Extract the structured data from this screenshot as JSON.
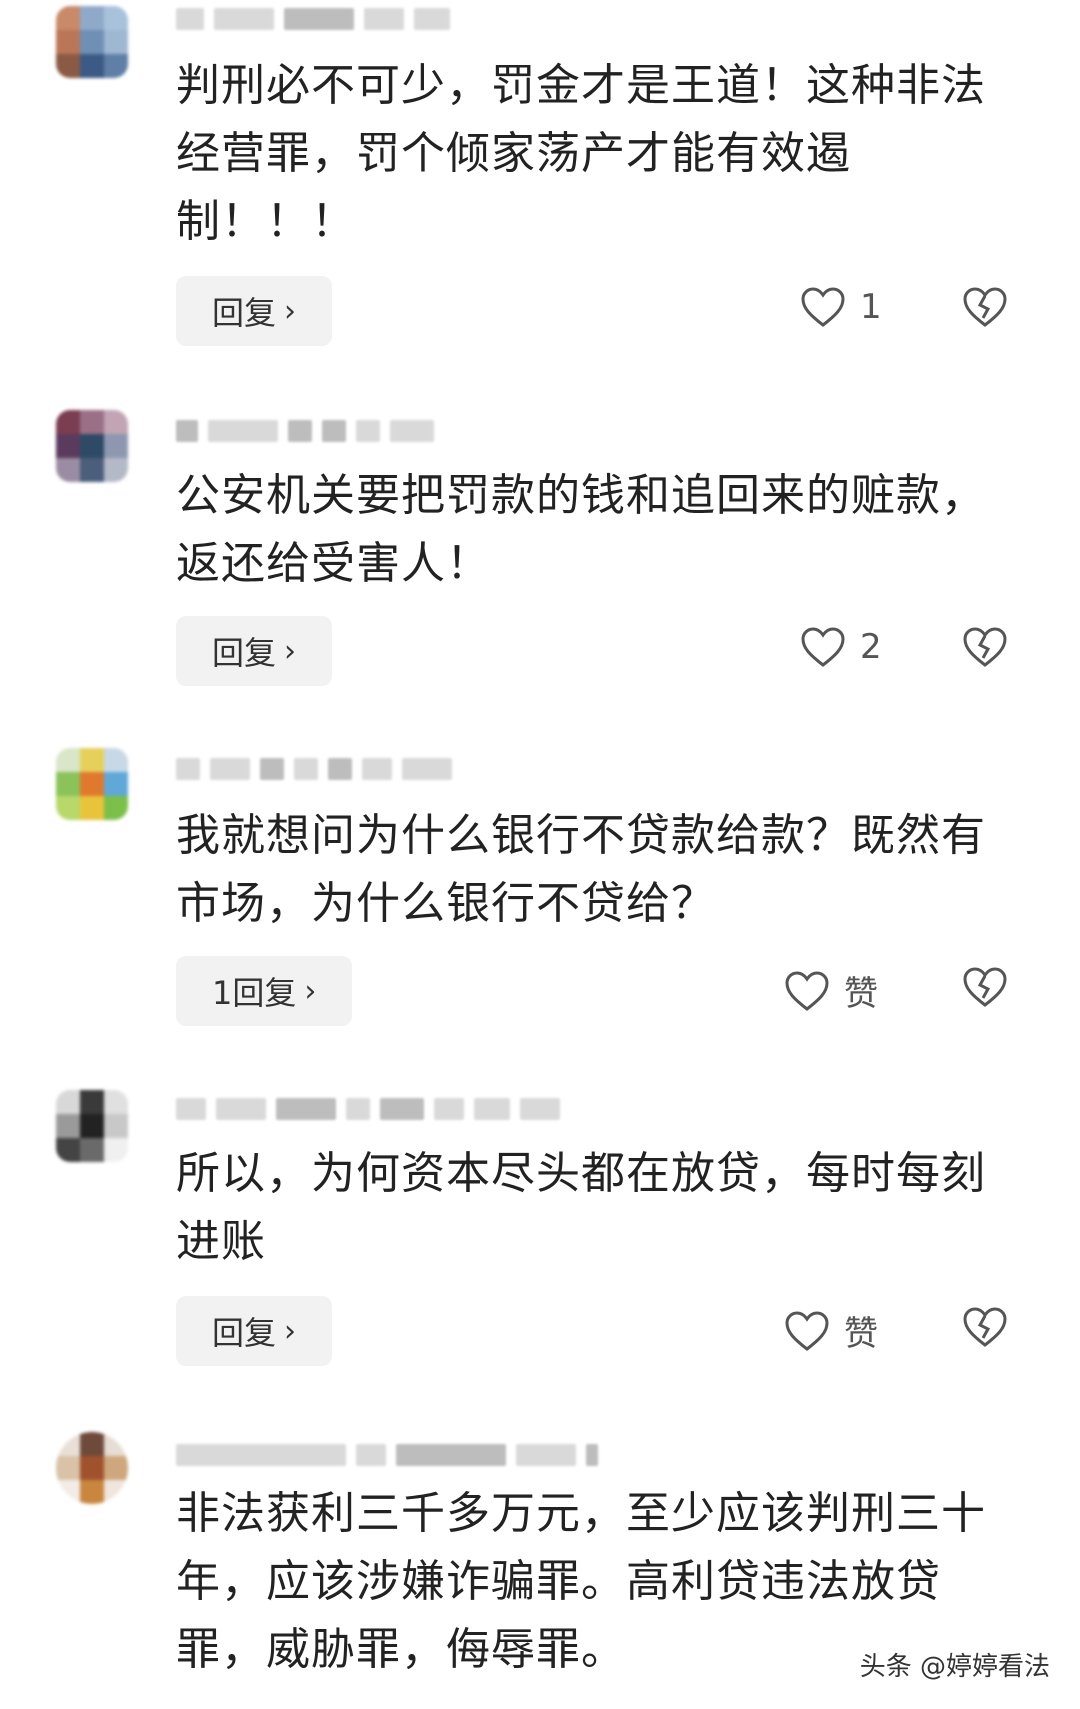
{
  "comments": [
    {
      "text": "判刑必不可少，罚金才是王道！这种非法经营罪，罚个倾家荡产才能有效遏制！！！",
      "reply_label": "回复",
      "like_label": "1"
    },
    {
      "text": "公安机关要把罚款的钱和追回来的赃款，返还给受害人！",
      "reply_label": "回复",
      "like_label": "2"
    },
    {
      "text": "我就想问为什么银行不贷款给款？既然有市场，为什么银行不贷给？",
      "reply_label": "1回复",
      "like_label": "赞"
    },
    {
      "text": "所以，为何资本尽头都在放贷，每时每刻进账",
      "reply_label": "回复",
      "like_label": "赞"
    },
    {
      "text": "非法获利三千多万元，至少应该判刑三十年，应该涉嫌诈骗罪。高利贷违法放贷罪，威胁罪，侮辱罪。",
      "reply_label": null,
      "like_label": null
    }
  ],
  "icons": {
    "like": "heart-outline-icon",
    "dislike": "broken-heart-icon",
    "reply_chevron": "chevron-right-icon"
  },
  "watermark": {
    "text": "头条 @婷婷看法"
  },
  "colors": {
    "text": "#222222",
    "reply_bg": "#f2f2f2",
    "icon": "#555555"
  }
}
